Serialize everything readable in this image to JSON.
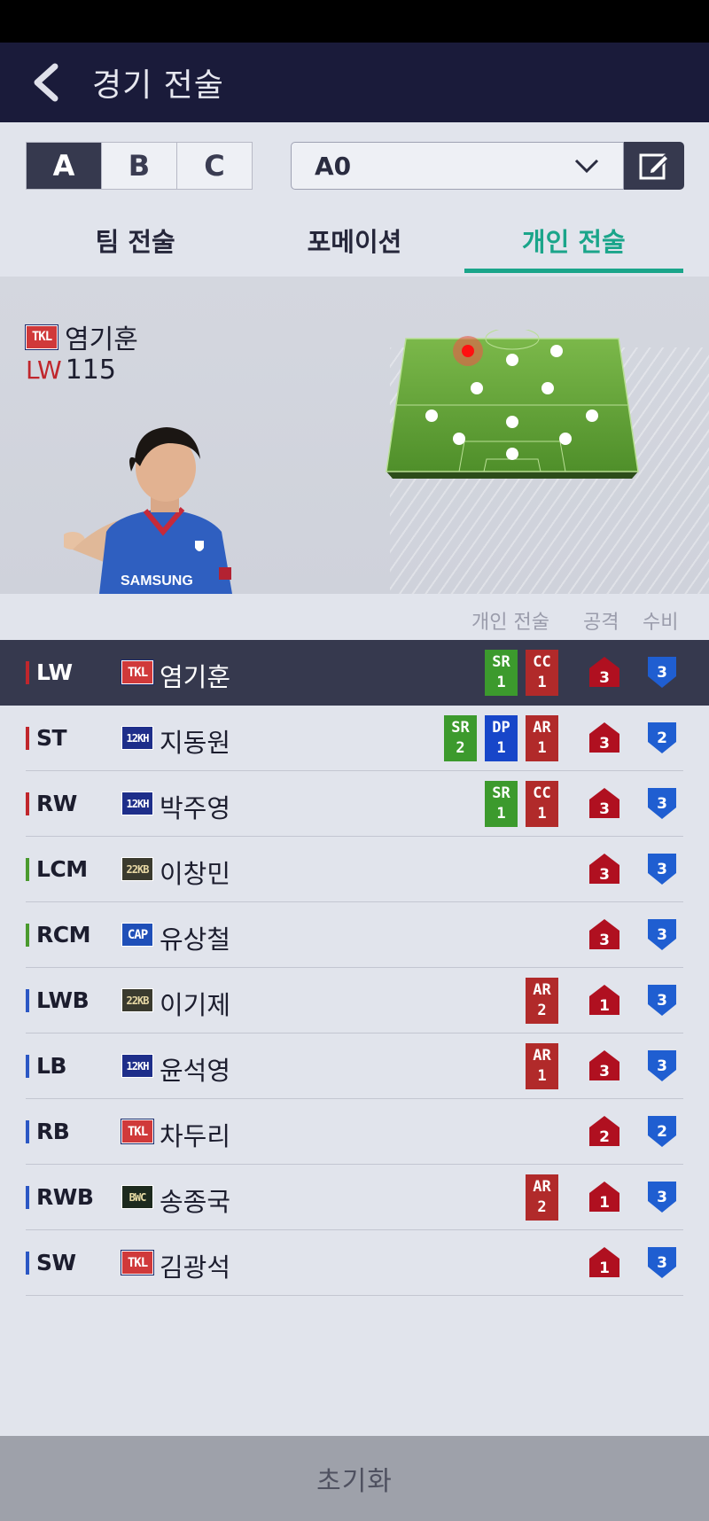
{
  "header": {
    "title": "경기 전술"
  },
  "segments": [
    {
      "label": "A",
      "active": true
    },
    {
      "label": "B",
      "active": false
    },
    {
      "label": "C",
      "active": false
    }
  ],
  "preset": {
    "value": "A0"
  },
  "tabs": [
    {
      "label": "팀 전술",
      "active": false
    },
    {
      "label": "포메이션",
      "active": false
    },
    {
      "label": "개인 전술",
      "active": true
    }
  ],
  "selected_player": {
    "season": "TKL",
    "name": "염기훈",
    "position": "LW",
    "ovr": "115",
    "jersey_text": "SAMSUNG"
  },
  "list_header": {
    "tactics": "개인 전술",
    "attack": "공격",
    "defense": "수비"
  },
  "rows": [
    {
      "pos": "LW",
      "group": "fw",
      "season": "TKL",
      "name": "염기훈",
      "chips": [
        {
          "code": "SR",
          "level": "1",
          "color": "green"
        },
        {
          "code": "CC",
          "level": "1",
          "color": "red"
        }
      ],
      "attack": "3",
      "defense": "3",
      "selected": true
    },
    {
      "pos": "ST",
      "group": "fw",
      "season": "12KH",
      "name": "지동원",
      "chips": [
        {
          "code": "SR",
          "level": "2",
          "color": "green"
        },
        {
          "code": "DP",
          "level": "1",
          "color": "blue"
        },
        {
          "code": "AR",
          "level": "1",
          "color": "red"
        }
      ],
      "attack": "3",
      "defense": "2"
    },
    {
      "pos": "RW",
      "group": "fw",
      "season": "12KH",
      "name": "박주영",
      "chips": [
        {
          "code": "SR",
          "level": "1",
          "color": "green"
        },
        {
          "code": "CC",
          "level": "1",
          "color": "red"
        }
      ],
      "attack": "3",
      "defense": "3"
    },
    {
      "pos": "LCM",
      "group": "mf",
      "season": "22KB",
      "name": "이창민",
      "chips": [],
      "attack": "3",
      "defense": "3"
    },
    {
      "pos": "RCM",
      "group": "mf",
      "season": "CAP",
      "name": "유상철",
      "chips": [],
      "attack": "3",
      "defense": "3"
    },
    {
      "pos": "LWB",
      "group": "df",
      "season": "22KB",
      "name": "이기제",
      "chips": [
        {
          "code": "AR",
          "level": "2",
          "color": "red"
        }
      ],
      "attack": "1",
      "defense": "3"
    },
    {
      "pos": "LB",
      "group": "df",
      "season": "12KH",
      "name": "윤석영",
      "chips": [
        {
          "code": "AR",
          "level": "1",
          "color": "red"
        }
      ],
      "attack": "3",
      "defense": "3"
    },
    {
      "pos": "RB",
      "group": "df",
      "season": "TKL",
      "name": "차두리",
      "chips": [],
      "attack": "2",
      "defense": "2"
    },
    {
      "pos": "RWB",
      "group": "df",
      "season": "BWC",
      "name": "송종국",
      "chips": [
        {
          "code": "AR",
          "level": "2",
          "color": "red"
        }
      ],
      "attack": "1",
      "defense": "3"
    },
    {
      "pos": "SW",
      "group": "df",
      "season": "TKL",
      "name": "김광석",
      "chips": [],
      "attack": "1",
      "defense": "3"
    }
  ],
  "reset": {
    "label": "초기화"
  },
  "colors": {
    "accent": "#1aa58a",
    "header_bg": "#1a1b3a",
    "selected_row": "#36394e",
    "fw": "#c0262c",
    "mf": "#4a9a2e",
    "df": "#2b57c4",
    "attack_icon": "#b01020",
    "defense_icon": "#1f5ed1"
  }
}
